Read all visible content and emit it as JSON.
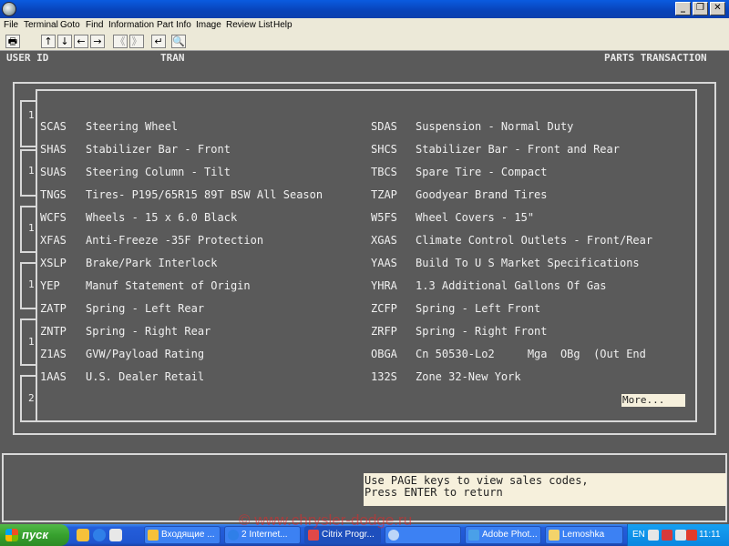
{
  "menu": [
    "File",
    "Terminal",
    "Goto",
    "Find",
    "Information",
    "Part Info",
    "Image",
    "Review List",
    "Help"
  ],
  "window_buttons": {
    "minimize": "_",
    "restore": "❐",
    "close": "✕"
  },
  "toolbar": {
    "print": "🖶",
    "up": "↑",
    "down": "↓",
    "left": "←",
    "right": "→",
    "first": "《",
    "last": "》",
    "enter": "↵",
    "search": "🔍"
  },
  "terminal": {
    "header": {
      "user_id": "USER ID",
      "tran": "TRAN",
      "title": "PARTS TRANSACTION"
    },
    "background_numbers": [
      "1",
      "1",
      "1",
      "1",
      "1",
      "2"
    ]
  },
  "options_left": [
    {
      "code": "SCAS",
      "desc": "Steering Wheel"
    },
    {
      "code": "SHAS",
      "desc": "Stabilizer Bar - Front"
    },
    {
      "code": "SUAS",
      "desc": "Steering Column - Tilt"
    },
    {
      "code": "TNGS",
      "desc": "Tires- P195/65R15 89T BSW All Season"
    },
    {
      "code": "WCFS",
      "desc": "Wheels - 15 x 6.0 Black"
    },
    {
      "code": "XFAS",
      "desc": "Anti-Freeze -35F Protection"
    },
    {
      "code": "XSLP",
      "desc": "Brake/Park Interlock"
    },
    {
      "code": "YEP",
      "desc": "Manuf Statement of Origin"
    },
    {
      "code": "ZATP",
      "desc": "Spring - Left Rear"
    },
    {
      "code": "ZNTP",
      "desc": "Spring - Right Rear"
    },
    {
      "code": "Z1AS",
      "desc": "GVW/Payload Rating"
    },
    {
      "code": "1AAS",
      "desc": "U.S. Dealer Retail"
    }
  ],
  "options_right": [
    {
      "code": "SDAS",
      "desc": "Suspension - Normal Duty"
    },
    {
      "code": "SHCS",
      "desc": "Stabilizer Bar - Front and Rear"
    },
    {
      "code": "TBCS",
      "desc": "Spare Tire - Compact"
    },
    {
      "code": "TZAP",
      "desc": "Goodyear Brand Tires"
    },
    {
      "code": "W5FS",
      "desc": "Wheel Covers - 15\""
    },
    {
      "code": "XGAS",
      "desc": "Climate Control Outlets - Front/Rear"
    },
    {
      "code": "YAAS",
      "desc": "Build To U S Market Specifications"
    },
    {
      "code": "YHRA",
      "desc": "1.3 Additional Gallons Of Gas"
    },
    {
      "code": "ZCFP",
      "desc": "Spring - Left Front"
    },
    {
      "code": "ZRFP",
      "desc": "Spring - Right Front"
    },
    {
      "code": "OBGA",
      "desc": "Cn 50530-Lo2     Mga  OBg  (Out End"
    },
    {
      "code": "132S",
      "desc": "Zone 32-New York"
    }
  ],
  "more_label": "More...",
  "message": {
    "line1": "Use PAGE keys to view sales codes,",
    "line2": "Press ENTER to return"
  },
  "taskbar": {
    "start": "пуск",
    "tasks": [
      "Входящие ...",
      "2 Internet...",
      "Citrix Progr...",
      "",
      "Adobe Phot...",
      "Lemoshka"
    ],
    "lang": "EN",
    "clock": "11:11"
  },
  "watermark": "© www.chrysler-dodge.ru"
}
